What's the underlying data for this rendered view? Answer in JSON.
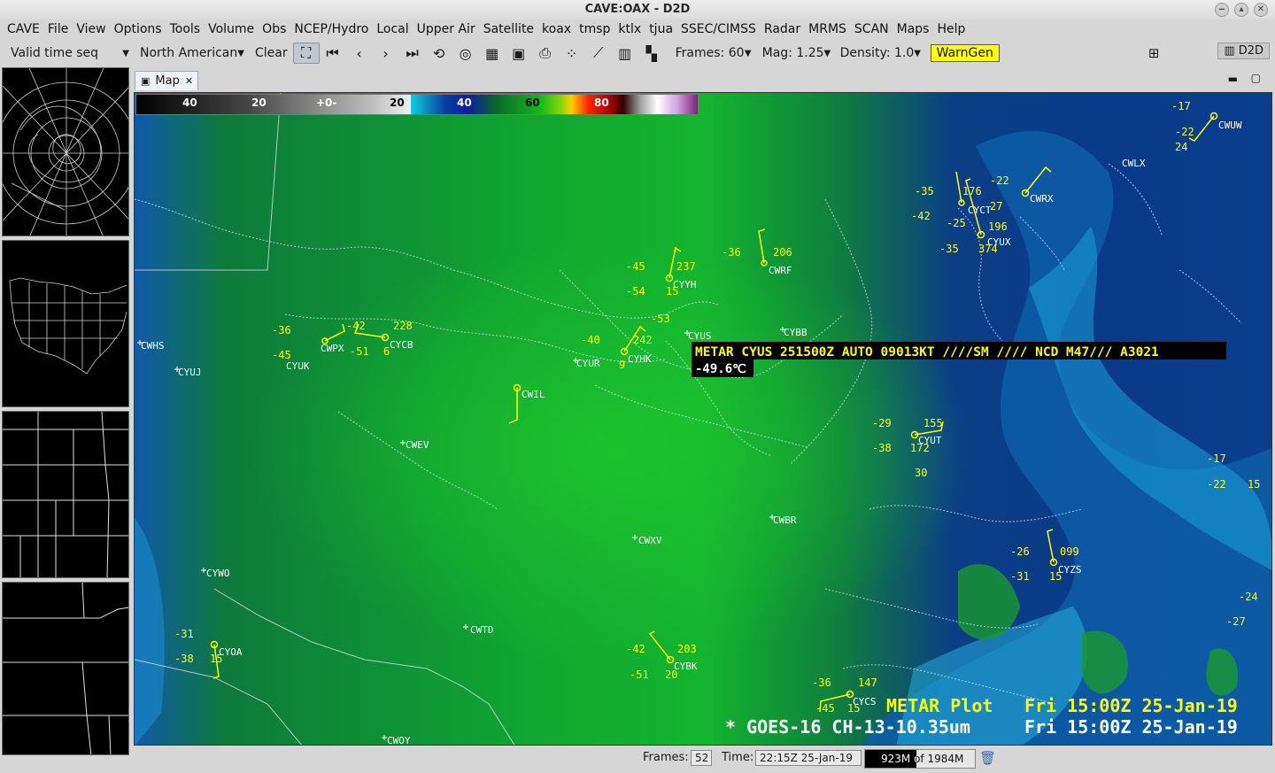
{
  "window": {
    "title": "CAVE:OAX - D2D"
  },
  "menubar": {
    "items": [
      "CAVE",
      "File",
      "View",
      "Options",
      "Tools",
      "Volume",
      "Obs",
      "NCEP/Hydro",
      "Local",
      "Upper Air",
      "Satellite",
      "koax",
      "tmsp",
      "ktlx",
      "tjua",
      "SSEC/CIMSS",
      "Radar",
      "MRMS",
      "SCAN",
      "Maps",
      "Help"
    ]
  },
  "toolbar": {
    "valid_time": "Valid time seq",
    "projection": "North American",
    "clear": "Clear",
    "frames": "Frames: 60",
    "mag": "Mag: 1.25",
    "density": "Density: 1.0",
    "warngen": "WarnGen",
    "perspective": "D2D"
  },
  "tab": {
    "label": "Map"
  },
  "colorbar": {
    "labels": [
      "40",
      "20",
      "+0-",
      "20",
      "40",
      "60",
      "80"
    ]
  },
  "sample": {
    "metar": "METAR CYUS 251500Z AUTO 09013KT ////SM //// NCD M47/// A3021",
    "value": "-49.6℃"
  },
  "legend": {
    "line1_left": "METAR Plot",
    "line1_right": "Fri 15:00Z 25-Jan-19",
    "line2_left": "* GOES-16 CH-13-10.35um",
    "line2_right": "Fri 15:00Z 25-Jan-19"
  },
  "stations_white": [
    "CWHS",
    "CYUJ",
    "CYUK",
    "CWPX",
    "CYCB",
    "CWIL",
    "CWEV",
    "CYUR",
    "CYHK",
    "CYUS",
    "CYYH",
    "CWRF",
    "CYBB",
    "CWBR",
    "CWXV",
    "CYWO",
    "CWTD",
    "CYOA",
    "CYBK",
    "CWOY",
    "CYCS",
    "CYUT",
    "CYZS",
    "CWRX",
    "CYUX",
    "CWUW",
    "CWLX",
    "CYCT"
  ],
  "metar_values": {
    "CYCB": [
      "-42",
      "228",
      "-51",
      "6"
    ],
    "CWPX": [
      "-36",
      "-45"
    ],
    "CYYH": [
      "-45",
      "237",
      "-54",
      "15"
    ],
    "CYHK": [
      "-40",
      "242",
      "-53",
      "9"
    ],
    "CWRF": [
      "-36",
      "206"
    ],
    "CYUX": [
      "-35",
      "176",
      "-22",
      "27",
      "-42",
      "-25",
      "196",
      "-35",
      "374"
    ],
    "CWUW": [
      "-17",
      "-22",
      "24"
    ],
    "CYUT": [
      "-29",
      "155",
      "-38",
      "172",
      "30"
    ],
    "CYZS": [
      "-26",
      "099",
      "-31",
      "15"
    ],
    "CYOA": [
      "-31",
      "-38",
      "15"
    ],
    "CYBK": [
      "-42",
      "203",
      "-51",
      "20"
    ],
    "CYCS": [
      "-36",
      "147",
      "-45",
      "15"
    ],
    "EDGE": [
      "-17",
      "-22",
      "15",
      "-24",
      "-27"
    ]
  },
  "status": {
    "frames_label": "Frames:",
    "frames_value": "52",
    "time_label": "Time:",
    "time_value": "22:15Z 25-Jan-19",
    "memory": "923M of 1984M"
  }
}
